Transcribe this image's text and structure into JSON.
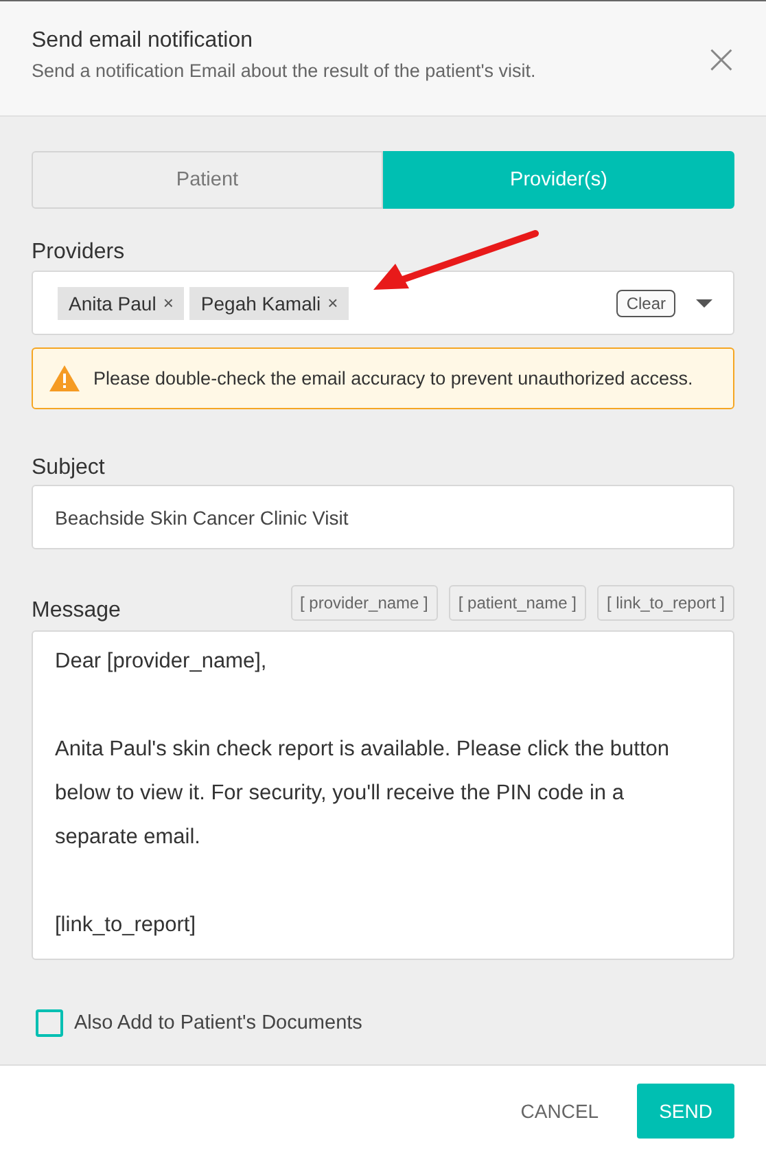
{
  "dialog": {
    "title": "Send email notification",
    "subtitle": "Send a notification Email about the result of the patient's visit.",
    "close": "×"
  },
  "tabs": [
    {
      "label": "Patient",
      "selected": false
    },
    {
      "label": "Provider(s)",
      "selected": true
    }
  ],
  "providers": {
    "label": "Providers",
    "chips": [
      {
        "name": "Anita Paul",
        "remove": "×"
      },
      {
        "name": "Pegah Kamali",
        "remove": "×"
      }
    ],
    "clear": "Clear"
  },
  "warning": {
    "text": "Please double-check the email accuracy to prevent unauthorized access."
  },
  "subject": {
    "label": "Subject",
    "value": "Beachside Skin Cancer Clinic Visit"
  },
  "message": {
    "label": "Message",
    "placeholders": [
      "[ provider_name ]",
      "[ patient_name ]",
      "[ link_to_report ]"
    ],
    "paragraphs": [
      "Dear [provider_name],",
      "Anita Paul's skin check report is available. Please click the button below to view it. For security, you'll receive the PIN code in a separate email.",
      "[link_to_report]"
    ]
  },
  "also_add": {
    "label": "Also Add to Patient's Documents",
    "checked": false
  },
  "buttons": [
    {
      "label": "CANCEL",
      "kind": "text"
    },
    {
      "label": "SEND",
      "kind": "primary"
    }
  ]
}
